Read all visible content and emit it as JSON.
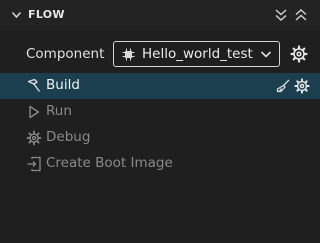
{
  "header": {
    "title": "FLOW",
    "chevron_icon": "chevron-down-icon",
    "expand_all_icon": "double-chevron-down-icon",
    "collapse_all_icon": "double-chevron-up-icon"
  },
  "component": {
    "label": "Component",
    "selected": "Hello_world_test",
    "chip_icon": "chip-icon",
    "dropdown_icon": "chevron-down-icon",
    "settings_icon": "gear-icon"
  },
  "actions": [
    {
      "label": "Build",
      "icon": "hammer-icon",
      "state": "selected",
      "extra_icons": [
        "broom-icon",
        "gear-icon"
      ]
    },
    {
      "label": "Run",
      "icon": "play-icon",
      "state": "disabled"
    },
    {
      "label": "Debug",
      "icon": "bug-gear-icon",
      "state": "disabled"
    },
    {
      "label": "Create Boot Image",
      "icon": "boot-image-icon",
      "state": "disabled"
    }
  ],
  "colors": {
    "background": "#1f1f1f",
    "selected_row": "#1b3f4f",
    "disabled_text": "#8a8a8a"
  }
}
